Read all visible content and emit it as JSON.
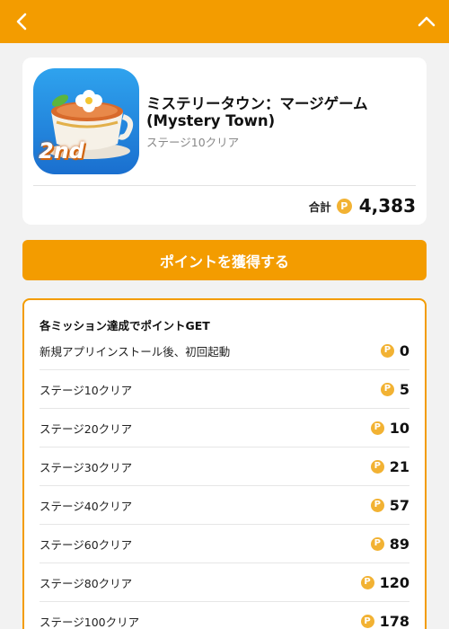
{
  "header": {
    "back_icon": "chevron-left-icon",
    "collapse_icon": "chevron-up-icon",
    "bg_color": "#f39c00"
  },
  "app": {
    "title": "ミステリータウン：マージゲーム (Mystery Town)",
    "subtitle": "ステージ10クリア",
    "icon_badge": "2nd",
    "total_label": "合計",
    "total_points": "4,383",
    "coin_symbol": "P"
  },
  "action": {
    "get_points_label": "ポイントを獲得する"
  },
  "missions": {
    "heading": "各ミッション達成でポイントGET",
    "items": [
      {
        "label": "新規アプリインストール後、初回起動",
        "points": "0"
      },
      {
        "label": "ステージ10クリア",
        "points": "5"
      },
      {
        "label": "ステージ20クリア",
        "points": "10"
      },
      {
        "label": "ステージ30クリア",
        "points": "21"
      },
      {
        "label": "ステージ40クリア",
        "points": "57"
      },
      {
        "label": "ステージ60クリア",
        "points": "89"
      },
      {
        "label": "ステージ80クリア",
        "points": "120"
      },
      {
        "label": "ステージ100クリア",
        "points": "178"
      }
    ]
  }
}
